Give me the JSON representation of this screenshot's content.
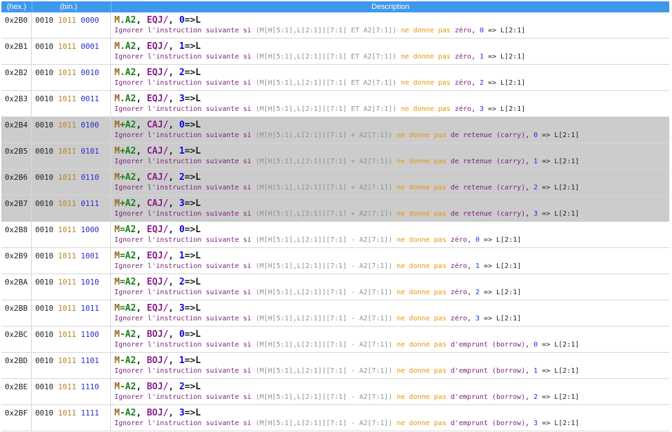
{
  "header": {
    "hex": "(hex.)",
    "bin": "(bin.)",
    "description": "Description"
  },
  "rows": [
    {
      "hex": "0x2B0",
      "b1": "0010",
      "b2": "1011",
      "b3": "0000",
      "m": "M",
      "sep": ".",
      "a": "A2",
      "op": "EQJ",
      "slash": "/",
      "n": "0",
      "expr": "(M[H[5:1],L[2:1]][7:1] ET A2[7:1])",
      "cond": "zéro",
      "pre": "",
      "gray": false
    },
    {
      "hex": "0x2B1",
      "b1": "0010",
      "b2": "1011",
      "b3": "0001",
      "m": "M",
      "sep": ".",
      "a": "A2",
      "op": "EQJ",
      "slash": "/",
      "n": "1",
      "expr": "(M[H[5:1],L[2:1]][7:1] ET A2[7:1])",
      "cond": "zéro",
      "pre": "",
      "gray": false
    },
    {
      "hex": "0x2B2",
      "b1": "0010",
      "b2": "1011",
      "b3": "0010",
      "m": "M",
      "sep": ".",
      "a": "A2",
      "op": "EQJ",
      "slash": "/",
      "n": "2",
      "expr": "(M[H[5:1],L[2:1]][7:1] ET A2[7:1])",
      "cond": "zéro",
      "pre": "",
      "gray": false
    },
    {
      "hex": "0x2B3",
      "b1": "0010",
      "b2": "1011",
      "b3": "0011",
      "m": "M",
      "sep": ".",
      "a": "A2",
      "op": "EQJ",
      "slash": "/",
      "n": "3",
      "expr": "(M[H[5:1],L[2:1]][7:1] ET A2[7:1])",
      "cond": "zéro",
      "pre": "",
      "gray": false
    },
    {
      "hex": "0x2B4",
      "b1": "0010",
      "b2": "1011",
      "b3": "0100",
      "m": "M",
      "sep": "+",
      "a": "A2",
      "op": "CAJ",
      "slash": "/",
      "n": "0",
      "expr": "(M[H[5:1],L[2:1]][7:1] + A2[7:1])",
      "cond": "de retenue (carry)",
      "pre": "",
      "gray": true
    },
    {
      "hex": "0x2B5",
      "b1": "0010",
      "b2": "1011",
      "b3": "0101",
      "m": "M",
      "sep": "+",
      "a": "A2",
      "op": "CAJ",
      "slash": "/",
      "n": "1",
      "expr": "(M[H[5:1],L[2:1]][7:1] + A2[7:1])",
      "cond": "de retenue (carry)",
      "pre": "",
      "gray": true
    },
    {
      "hex": "0x2B6",
      "b1": "0010",
      "b2": "1011",
      "b3": "0110",
      "m": "M",
      "sep": "+",
      "a": "A2",
      "op": "CAJ",
      "slash": "/",
      "n": "2",
      "expr": "(M[H[5:1],L[2:1]][7:1] + A2[7:1])",
      "cond": "de retenue (carry)",
      "pre": "",
      "gray": true
    },
    {
      "hex": "0x2B7",
      "b1": "0010",
      "b2": "1011",
      "b3": "0111",
      "m": "M",
      "sep": "+",
      "a": "A2",
      "op": "CAJ",
      "slash": "/",
      "n": "3",
      "expr": "(M[H[5:1],L[2:1]][7:1] + A2[7:1])",
      "cond": "de retenue (carry)",
      "pre": "",
      "gray": true
    },
    {
      "hex": "0x2B8",
      "b1": "0010",
      "b2": "1011",
      "b3": "1000",
      "m": "M",
      "sep": "=",
      "a": "A2",
      "op": "EQJ",
      "slash": "/",
      "n": "0",
      "expr": "(M[H[5:1],L[2:1]][7:1] - A2[7:1])",
      "cond": "zéro",
      "pre": "",
      "gray": false
    },
    {
      "hex": "0x2B9",
      "b1": "0010",
      "b2": "1011",
      "b3": "1001",
      "m": "M",
      "sep": "=",
      "a": "A2",
      "op": "EQJ",
      "slash": "/",
      "n": "1",
      "expr": "(M[H[5:1],L[2:1]][7:1] - A2[7:1])",
      "cond": "zéro",
      "pre": "",
      "gray": false
    },
    {
      "hex": "0x2BA",
      "b1": "0010",
      "b2": "1011",
      "b3": "1010",
      "m": "M",
      "sep": "=",
      "a": "A2",
      "op": "EQJ",
      "slash": "/",
      "n": "2",
      "expr": "(M[H[5:1],L[2:1]][7:1] - A2[7:1])",
      "cond": "zéro",
      "pre": "",
      "gray": false
    },
    {
      "hex": "0x2BB",
      "b1": "0010",
      "b2": "1011",
      "b3": "1011",
      "m": "M",
      "sep": "=",
      "a": "A2",
      "op": "EQJ",
      "slash": "/",
      "n": "3",
      "expr": "(M[H[5:1],L[2:1]][7:1] - A2[7:1])",
      "cond": "zéro",
      "pre": "",
      "gray": false
    },
    {
      "hex": "0x2BC",
      "b1": "0010",
      "b2": "1011",
      "b3": "1100",
      "m": "M",
      "sep": "-",
      "a": "A2",
      "op": "BOJ",
      "slash": "/",
      "n": "0",
      "expr": "(M[H[5:1],L[2:1]][7:1] - A2[7:1])",
      "cond": "d'emprunt (borrow)",
      "pre": "",
      "gray": false
    },
    {
      "hex": "0x2BD",
      "b1": "0010",
      "b2": "1011",
      "b3": "1101",
      "m": "M",
      "sep": "-",
      "a": "A2",
      "op": "BOJ",
      "slash": "/",
      "n": "1",
      "expr": "(M[H[5:1],L[2:1]][7:1] - A2[7:1])",
      "cond": "d'emprunt (borrow)",
      "pre": "",
      "gray": false
    },
    {
      "hex": "0x2BE",
      "b1": "0010",
      "b2": "1011",
      "b3": "1110",
      "m": "M",
      "sep": "-",
      "a": "A2",
      "op": "BOJ",
      "slash": "/",
      "n": "2",
      "expr": "(M[H[5:1],L[2:1]][7:1] - A2[7:1])",
      "cond": "d'emprunt (borrow)",
      "pre": "",
      "gray": false
    },
    {
      "hex": "0x2BF",
      "b1": "0010",
      "b2": "1011",
      "b3": "1111",
      "m": "M",
      "sep": "-",
      "a": "A2",
      "op": "BOJ",
      "slash": "/",
      "n": "3",
      "expr": "(M[H[5:1],L[2:1]][7:1] - A2[7:1])",
      "cond": "d'emprunt (borrow)",
      "pre": "",
      "gray": false
    }
  ],
  "text": {
    "comma": ",",
    "arrow_l": "=>L",
    "lead": "Ignorer l'instruction suivante si",
    "ne_donne_pas": "ne donne pas",
    "arrow_target": "=> L[2:1]"
  }
}
